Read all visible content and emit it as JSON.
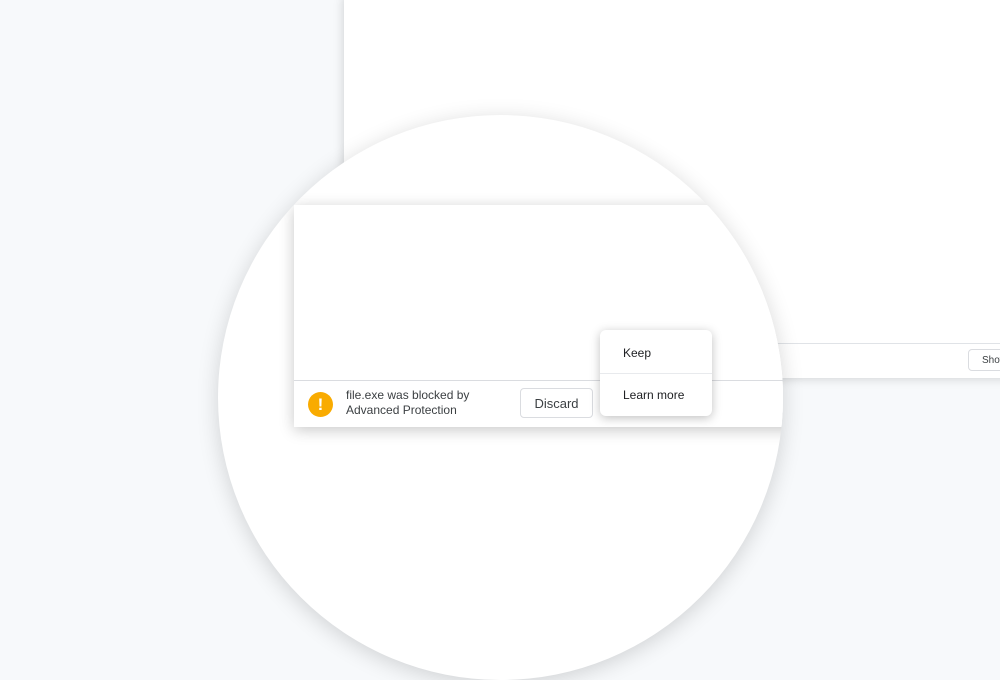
{
  "background_window": {
    "show_all_label": "Show"
  },
  "download_shelf": {
    "message_line1": "file.exe was blocked by",
    "message_line2": "Advanced Protection",
    "discard_label": "Discard",
    "warning_icon_glyph": "!",
    "warning_color": "#f9ab00"
  },
  "context_menu": {
    "items": [
      {
        "label": "Keep"
      },
      {
        "label": "Learn more"
      }
    ]
  }
}
